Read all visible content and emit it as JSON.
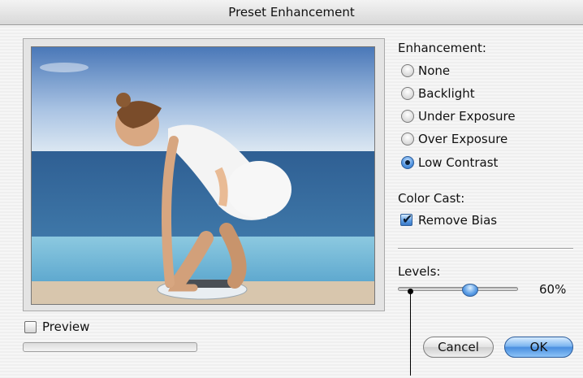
{
  "window": {
    "title": "Preset Enhancement"
  },
  "enhancement": {
    "label": "Enhancement:",
    "selected": "Low Contrast",
    "options": [
      {
        "label": "None",
        "selected": false
      },
      {
        "label": "Backlight",
        "selected": false
      },
      {
        "label": "Under Exposure",
        "selected": false
      },
      {
        "label": "Over Exposure",
        "selected": false
      },
      {
        "label": "Low Contrast",
        "selected": true
      }
    ]
  },
  "color_cast": {
    "label": "Color Cast:",
    "remove_bias": {
      "label": "Remove Bias",
      "checked": true
    }
  },
  "levels": {
    "label": "Levels:",
    "value": 60,
    "display": "60%"
  },
  "preview": {
    "label": "Preview",
    "checked": false,
    "progress": 0
  },
  "buttons": {
    "cancel": "Cancel",
    "ok": "OK"
  },
  "colors": {
    "accent": "#4a8fe0",
    "selected_radio": "#2d6bbd"
  }
}
